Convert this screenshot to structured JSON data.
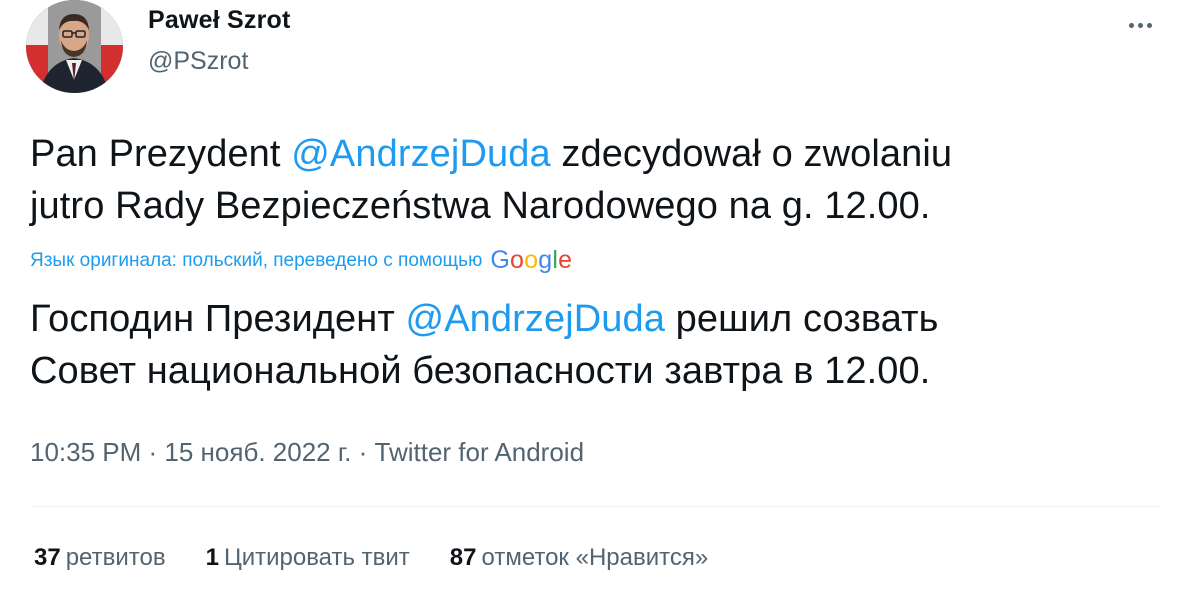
{
  "author": {
    "name": "Paweł Szrot",
    "handle": "@PSzrot"
  },
  "tweet": {
    "original": {
      "part1": "Pan Prezydent ",
      "mention": "@AndrzejDuda",
      "part2": " zdecydował o zwolaniu",
      "line2": "jutro Rady Bezpieczeństwa Narodowego na g. 12.00."
    },
    "translation_note": "Язык оригинала: польский, переведено с помощью",
    "translation_provider": "Google",
    "translated": {
      "part1": "Господин Президент ",
      "mention": "@AndrzejDuda",
      "part2": " решил созвать",
      "line2": "Совет национальной безопасности завтра в 12.00."
    }
  },
  "meta": {
    "time": "10:35 PM",
    "separator": " · ",
    "date": "15 нояб. 2022 г.",
    "source": "Twitter for Android"
  },
  "stats": {
    "retweets_count": "37",
    "retweets_label": "ретвитов",
    "quotes_count": "1",
    "quotes_label": "Цитировать твит",
    "likes_count": "87",
    "likes_label": "отметок «Нравится»"
  },
  "colors": {
    "accent": "#1d9bf0",
    "text": "#0f1419",
    "secondary": "#536471",
    "google_blue": "#4285f4",
    "google_red": "#ea4335",
    "google_yellow": "#fbbc05",
    "google_green": "#34a853"
  },
  "icons": {
    "more": "more-horizontal-icon"
  }
}
